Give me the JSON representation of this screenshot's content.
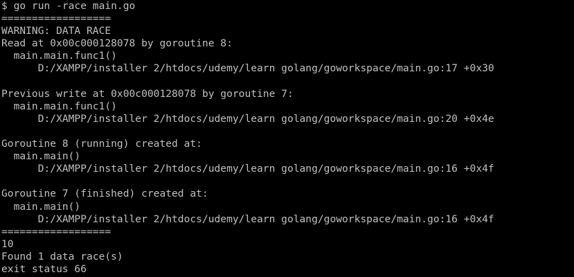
{
  "terminal": {
    "colors": {
      "background": "#000000",
      "foreground": "#c0c0c0"
    },
    "lines": [
      "$ go run -race main.go",
      "==================",
      "WARNING: DATA RACE",
      "Read at 0x00c000128078 by goroutine 8:",
      "  main.main.func1()",
      "      D:/XAMPP/installer 2/htdocs/udemy/learn golang/goworkspace/main.go:17 +0x30",
      "",
      "Previous write at 0x00c000128078 by goroutine 7:",
      "  main.main.func1()",
      "      D:/XAMPP/installer 2/htdocs/udemy/learn golang/goworkspace/main.go:20 +0x4e",
      "",
      "Goroutine 8 (running) created at:",
      "  main.main()",
      "      D:/XAMPP/installer 2/htdocs/udemy/learn golang/goworkspace/main.go:16 +0x4f",
      "",
      "Goroutine 7 (finished) created at:",
      "  main.main()",
      "      D:/XAMPP/installer 2/htdocs/udemy/learn golang/goworkspace/main.go:16 +0x4f",
      "==================",
      "10",
      "Found 1 data race(s)",
      "exit status 66"
    ]
  }
}
